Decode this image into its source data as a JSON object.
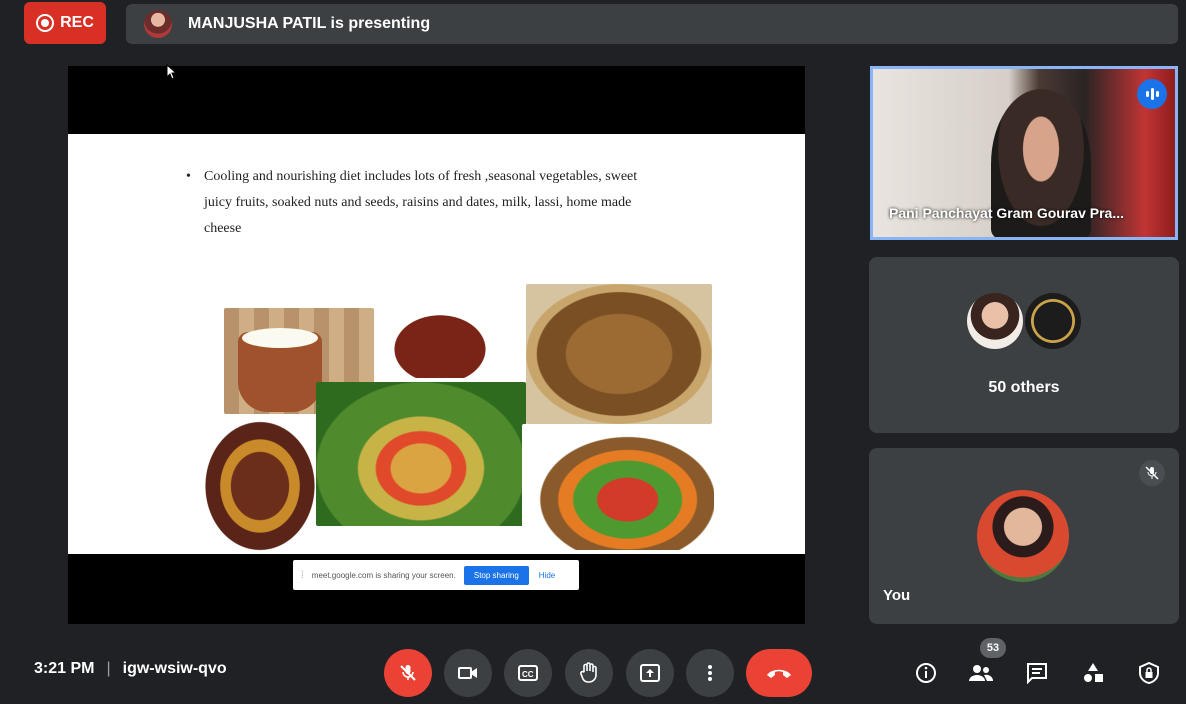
{
  "recording": {
    "label": "REC"
  },
  "presenter": {
    "text": "MANJUSHA PATIL is presenting"
  },
  "slide": {
    "bullet": "Cooling and nourishing diet includes lots of fresh ,seasonal vegetables, sweet juicy fruits, soaked nuts and seeds, raisins and dates, milk, lassi, home made cheese"
  },
  "share_bar": {
    "message": "meet.google.com is sharing your screen.",
    "stop_label": "Stop sharing",
    "hide_label": "Hide"
  },
  "tiles": {
    "speaker_name": "Pani Panchayat Gram Gourav Pra...",
    "others_label": "50 others",
    "self_label": "You"
  },
  "meeting": {
    "time": "3:21 PM",
    "separator": "|",
    "code": "igw-wsiw-qvo"
  },
  "participants_count": "53",
  "colors": {
    "accent": "#1a73e8",
    "danger": "#ea4335",
    "tile": "#3c4043",
    "background": "#202124"
  },
  "icons": {
    "controls": [
      "mic-off-icon",
      "camera-icon",
      "captions-icon",
      "raise-hand-icon",
      "present-icon",
      "more-icon",
      "hangup-icon"
    ],
    "right": [
      "info-icon",
      "people-icon",
      "chat-icon",
      "activities-icon",
      "host-controls-icon"
    ]
  }
}
